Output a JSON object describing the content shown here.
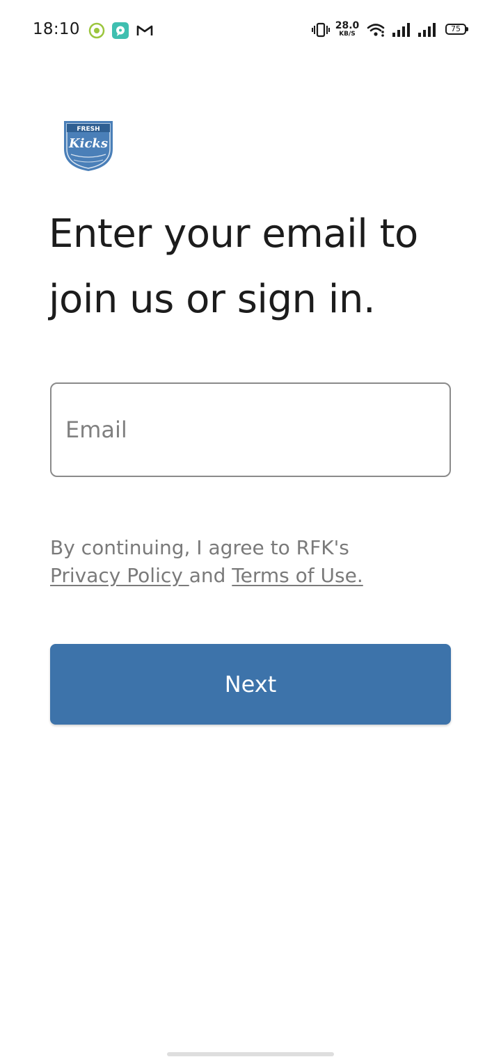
{
  "status_bar": {
    "time": "18:10",
    "net_speed_value": "28.0",
    "net_speed_unit": "KB/S",
    "battery_level": "75",
    "notification_icons": [
      "record-icon",
      "chat-bubble-icon",
      "gmail-icon"
    ],
    "system_icons": [
      "vibrate-icon",
      "wifi-icon",
      "signal-icon",
      "signal-icon",
      "battery-icon"
    ]
  },
  "brand": {
    "logo_icon": "fresh-kicks-logo",
    "logo_text_top": "FRESH",
    "logo_text_main": "Kicks",
    "accent_color": "#3d73aa"
  },
  "main": {
    "heading_line1": "Enter your email to",
    "heading_line2": "join us or sign in.",
    "email_placeholder": "Email",
    "email_value": "",
    "legal_intro": "By continuing, I agree to RFK's",
    "privacy_link": "Privacy Policy ",
    "legal_and": " and ",
    "terms_link": "Terms of Use.",
    "next_label": "Next"
  }
}
